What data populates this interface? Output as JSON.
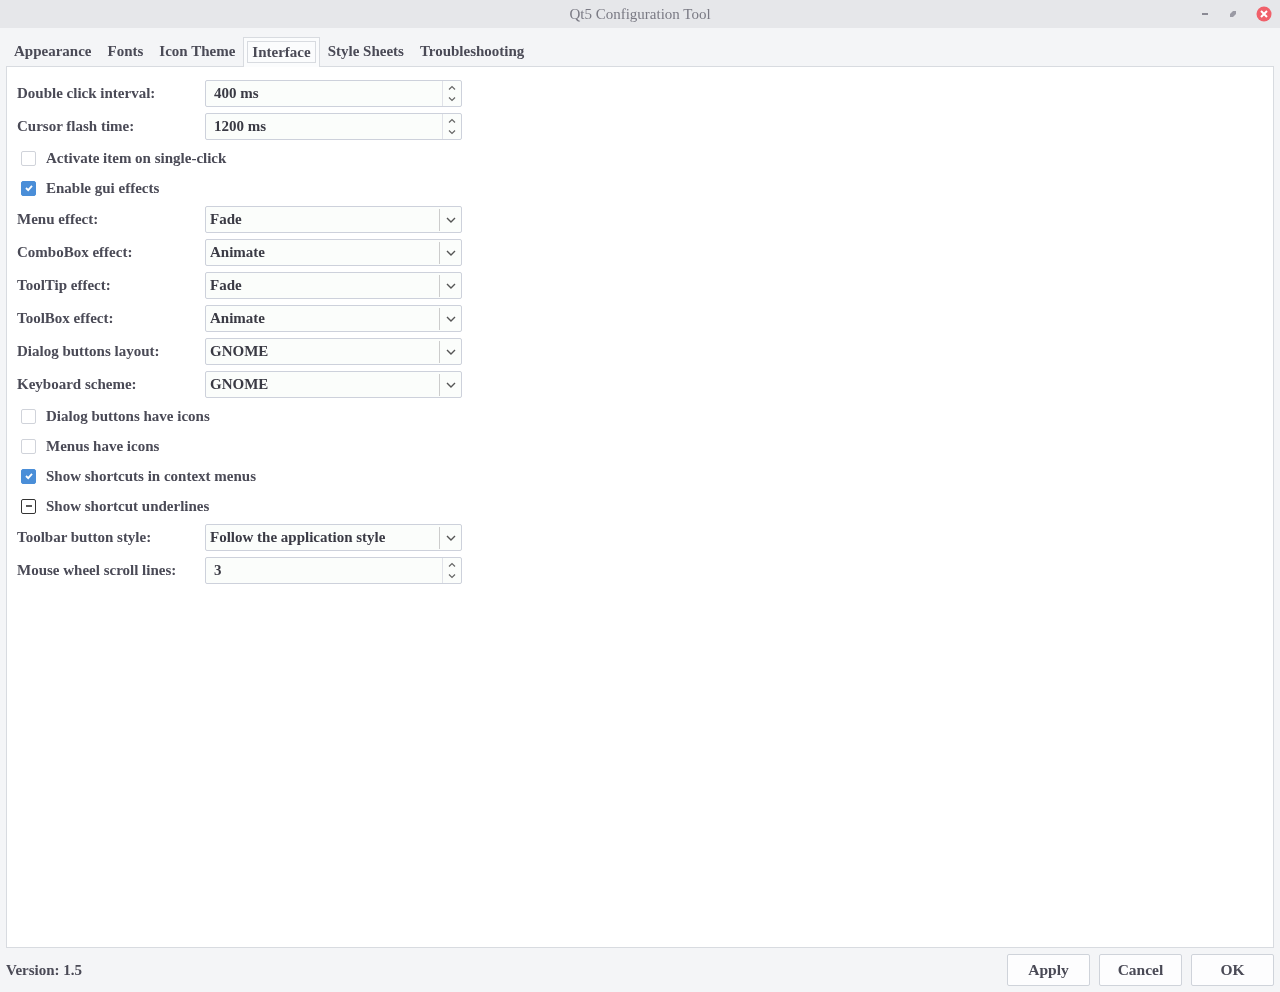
{
  "window": {
    "title": "Qt5 Configuration Tool"
  },
  "tabs": [
    {
      "label": "Appearance",
      "selected": false
    },
    {
      "label": "Fonts",
      "selected": false
    },
    {
      "label": "Icon Theme",
      "selected": false
    },
    {
      "label": "Interface",
      "selected": true
    },
    {
      "label": "Style Sheets",
      "selected": false
    },
    {
      "label": "Troubleshooting",
      "selected": false
    }
  ],
  "settings": [
    {
      "kind": "spin",
      "label": "Double click interval:",
      "value": "400 ms"
    },
    {
      "kind": "spin",
      "label": "Cursor flash time:",
      "value": "1200 ms"
    },
    {
      "kind": "checkbox",
      "label": "Activate item on single-click",
      "checked": false,
      "partial": false
    },
    {
      "kind": "checkbox",
      "label": "Enable gui effects",
      "checked": true,
      "partial": false
    },
    {
      "kind": "combo",
      "label": "Menu effect:",
      "value": "Fade"
    },
    {
      "kind": "combo",
      "label": "ComboBox effect:",
      "value": "Animate"
    },
    {
      "kind": "combo",
      "label": "ToolTip effect:",
      "value": "Fade"
    },
    {
      "kind": "combo",
      "label": "ToolBox effect:",
      "value": "Animate"
    },
    {
      "kind": "combo",
      "label": "Dialog buttons layout:",
      "value": "GNOME"
    },
    {
      "kind": "combo",
      "label": "Keyboard scheme:",
      "value": "GNOME"
    },
    {
      "kind": "checkbox",
      "label": "Dialog buttons have icons",
      "checked": false,
      "partial": false
    },
    {
      "kind": "checkbox",
      "label": "Menus have icons",
      "checked": false,
      "partial": false
    },
    {
      "kind": "checkbox",
      "label": "Show shortcuts in context menus",
      "checked": true,
      "partial": false
    },
    {
      "kind": "checkbox",
      "label": "Show shortcut underlines",
      "checked": true,
      "partial": true
    },
    {
      "kind": "combo",
      "label": "Toolbar button style:",
      "value": "Follow the application style"
    },
    {
      "kind": "spin",
      "label": "Mouse wheel scroll lines:",
      "value": "3"
    }
  ],
  "footer": {
    "version": "Version: 1.5",
    "buttons": [
      "Apply",
      "Cancel",
      "OK"
    ]
  }
}
